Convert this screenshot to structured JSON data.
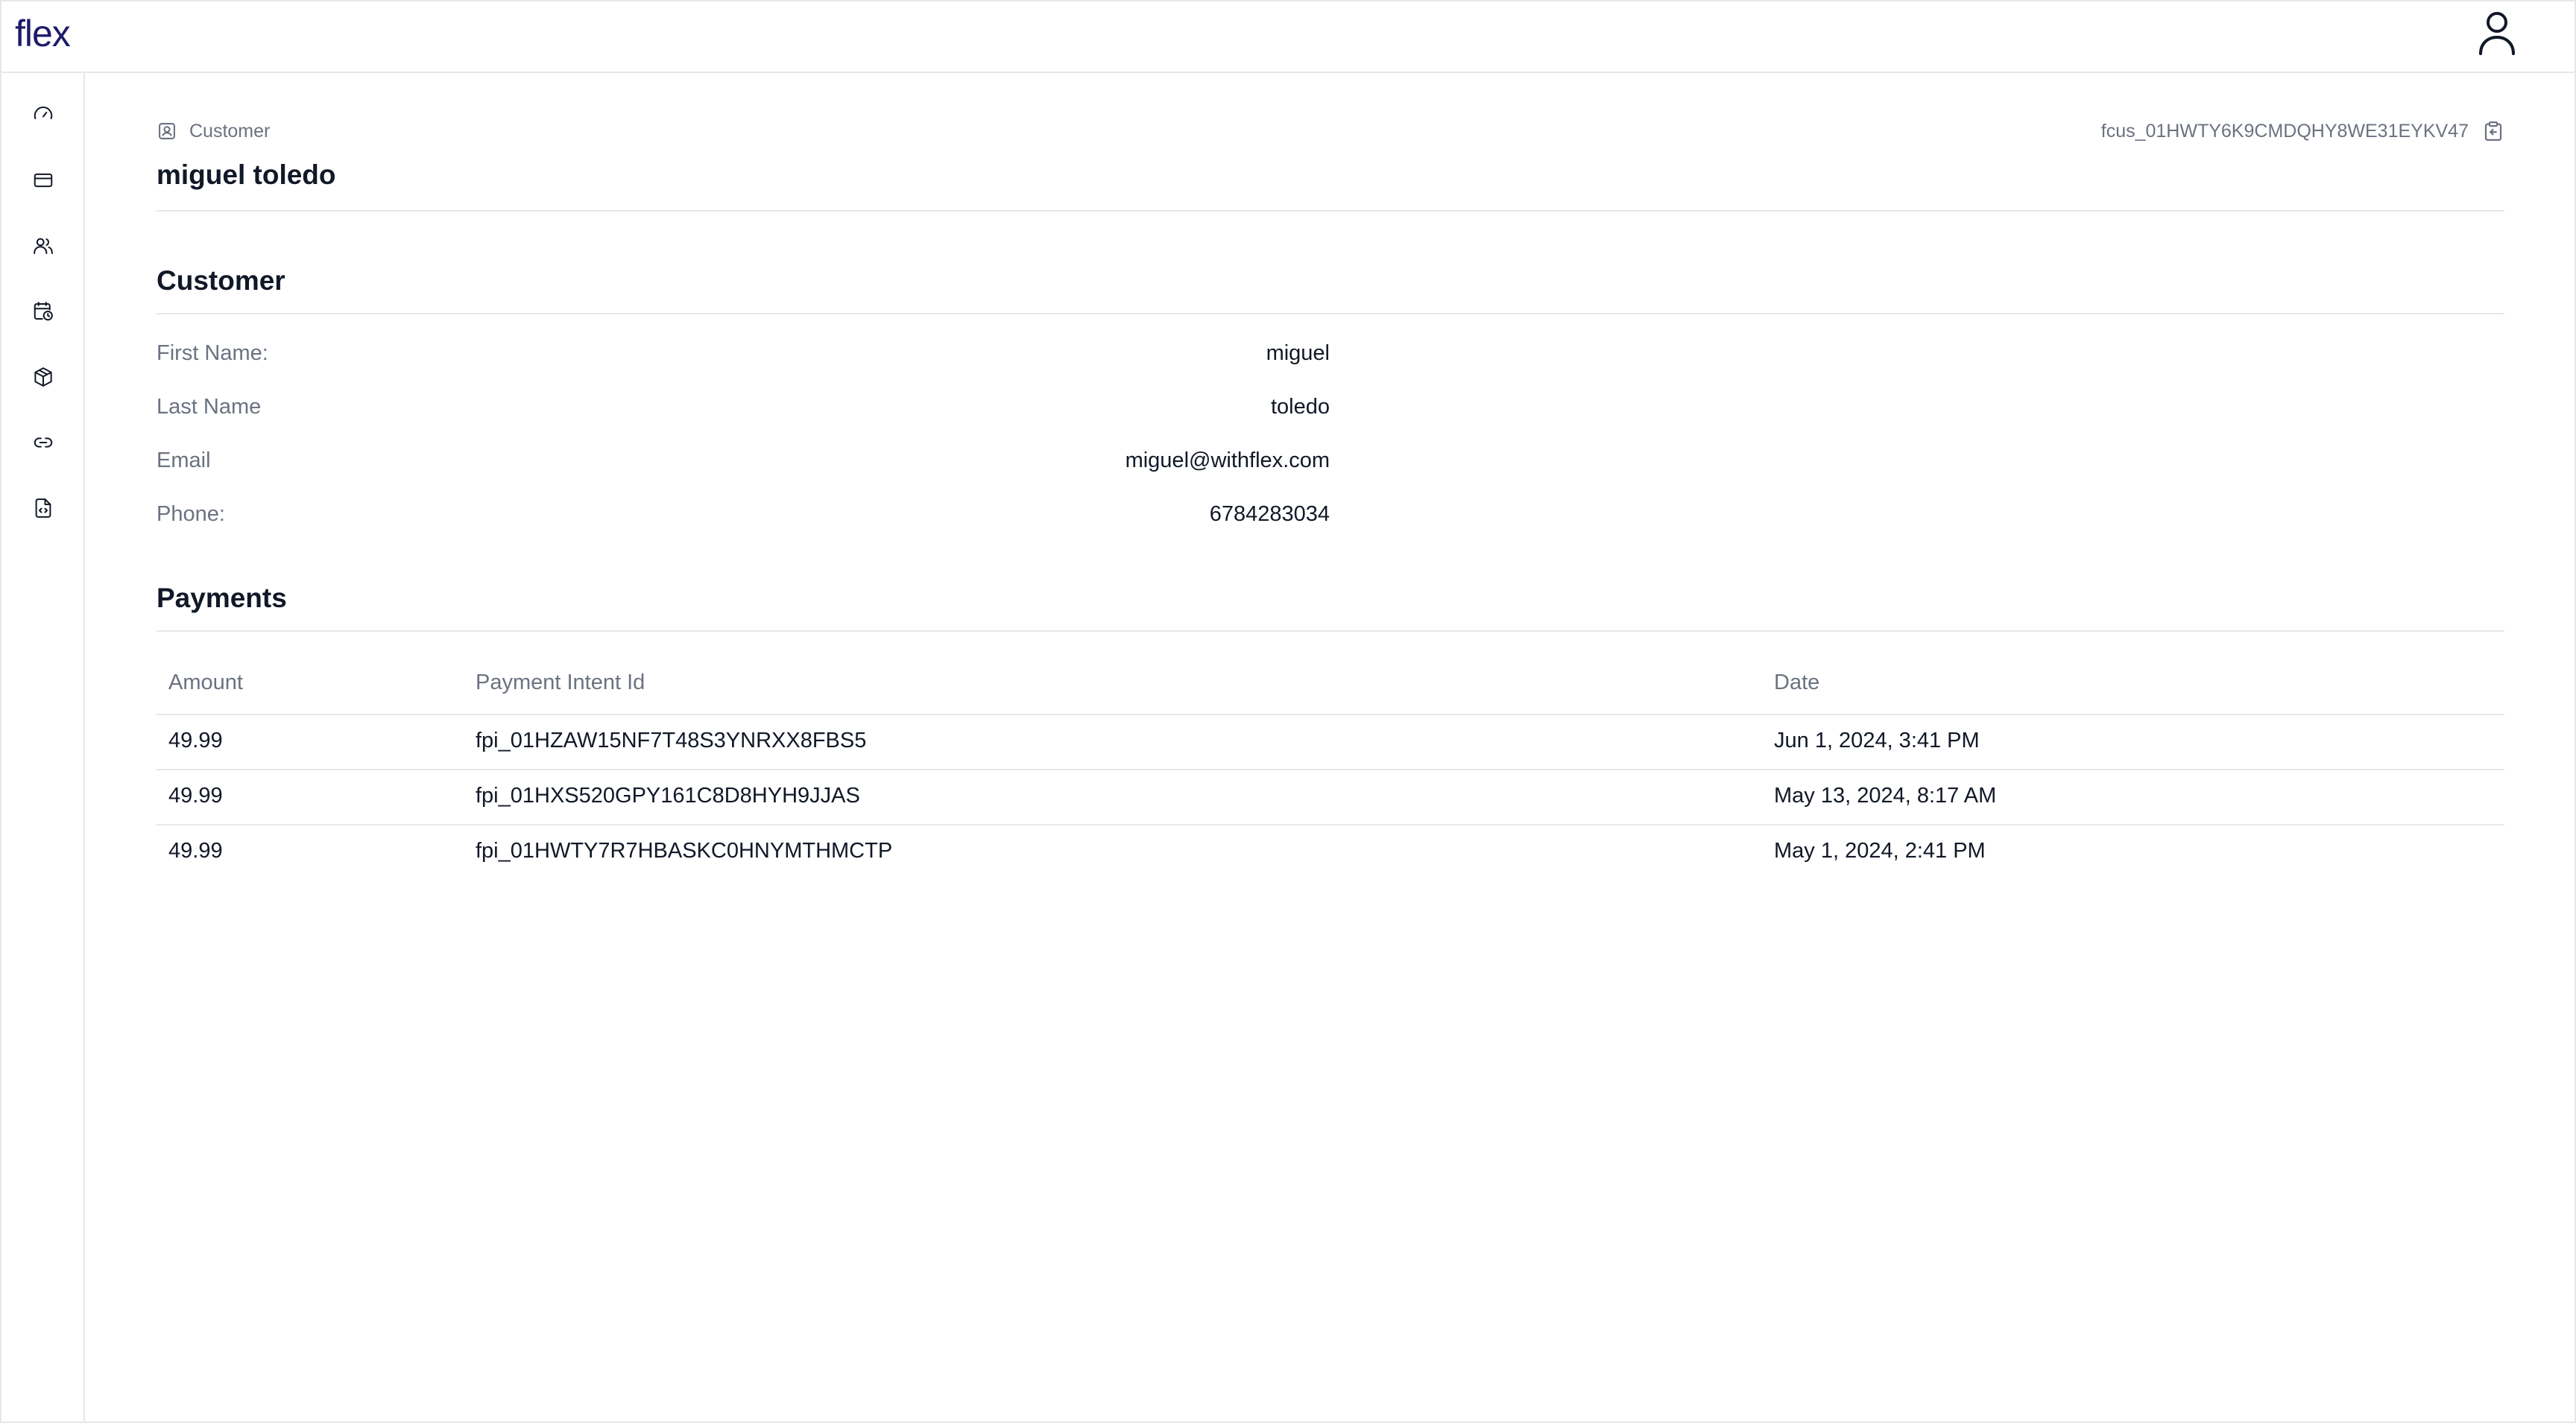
{
  "app": {
    "logo": "flex"
  },
  "nav": [
    {
      "icon": "gauge-icon",
      "name": "nav-dashboard"
    },
    {
      "icon": "credit-card-icon",
      "name": "nav-payments"
    },
    {
      "icon": "users-icon",
      "name": "nav-customers"
    },
    {
      "icon": "calendar-clock-icon",
      "name": "nav-subscriptions"
    },
    {
      "icon": "package-icon",
      "name": "nav-products"
    },
    {
      "icon": "link-icon",
      "name": "nav-links"
    },
    {
      "icon": "file-code-icon",
      "name": "nav-developers"
    }
  ],
  "header": {
    "breadcrumb": "Customer",
    "title": "miguel toledo",
    "customer_id": "fcus_01HWTY6K9CMDQHY8WE31EYKV47"
  },
  "customer": {
    "section_title": "Customer",
    "fields": [
      {
        "label": "First Name:",
        "value": "miguel"
      },
      {
        "label": "Last Name",
        "value": "toledo"
      },
      {
        "label": "Email",
        "value": "miguel@withflex.com"
      },
      {
        "label": "Phone:",
        "value": "6784283034"
      }
    ]
  },
  "payments": {
    "section_title": "Payments",
    "columns": [
      "Amount",
      "Payment Intent Id",
      "Date"
    ],
    "rows": [
      {
        "amount": "49.99",
        "intent_id": "fpi_01HZAW15NF7T48S3YNRXX8FBS5",
        "date": "Jun 1, 2024, 3:41 PM"
      },
      {
        "amount": "49.99",
        "intent_id": "fpi_01HXS520GPY161C8D8HYH9JJAS",
        "date": "May 13, 2024, 8:17 AM"
      },
      {
        "amount": "49.99",
        "intent_id": "fpi_01HWTY7R7HBASKC0HNYMTHMCTP",
        "date": "May 1, 2024, 2:41 PM"
      }
    ]
  },
  "colors": {
    "logo": "#1e1b6b",
    "muted_text": "#6b7280",
    "border": "#e5e7eb"
  }
}
